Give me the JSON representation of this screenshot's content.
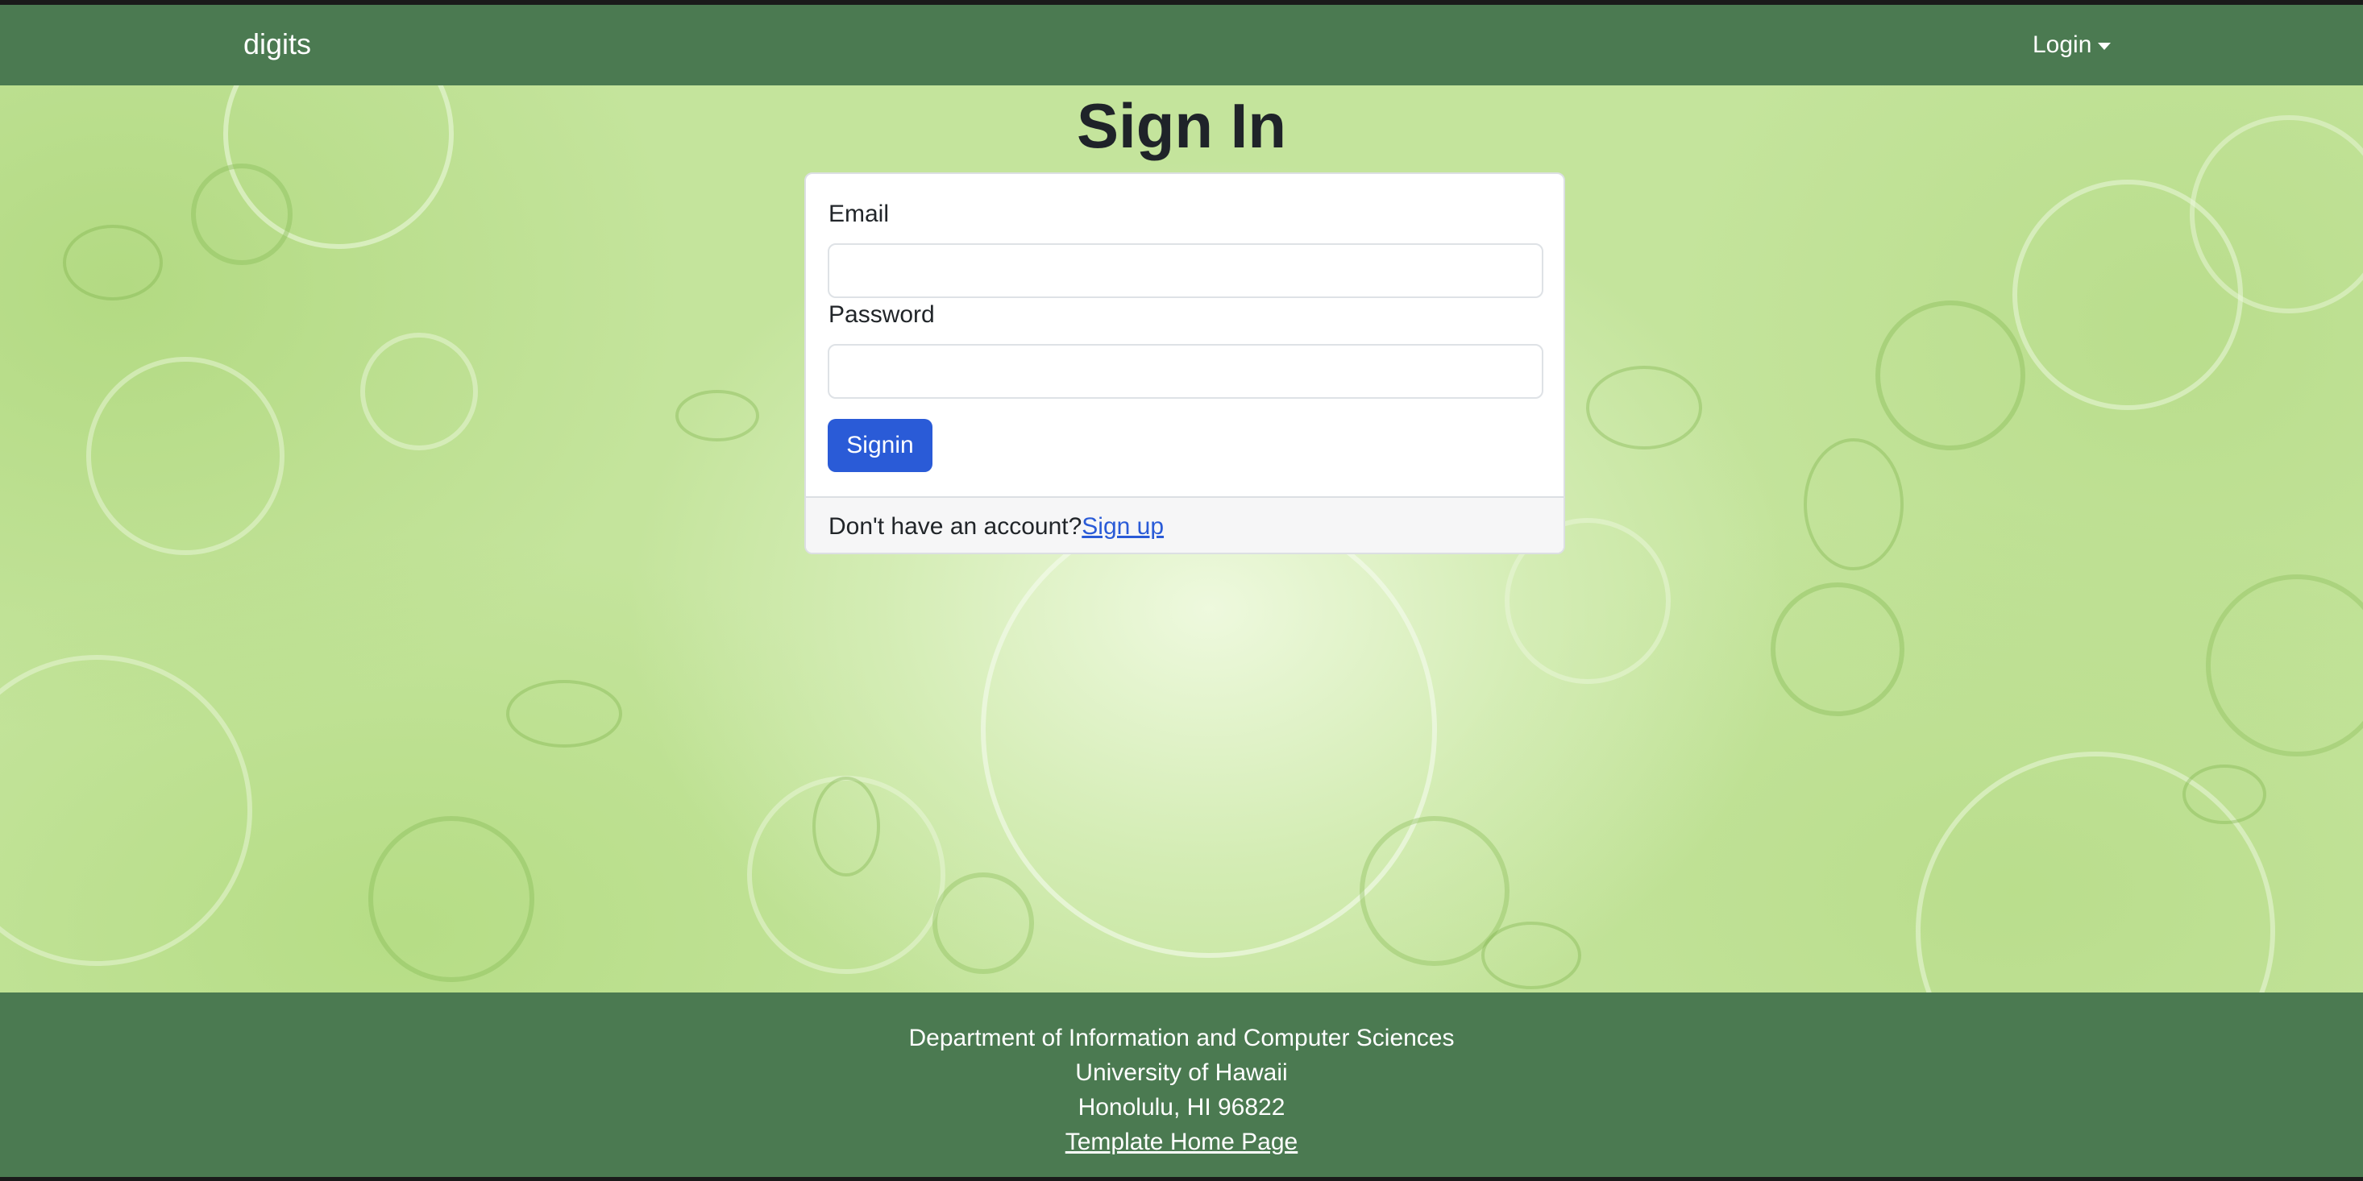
{
  "navbar": {
    "brand": "digits",
    "login_menu": "Login"
  },
  "page": {
    "title": "Sign In"
  },
  "form": {
    "email_label": "Email",
    "email_value": "",
    "password_label": "Password",
    "password_value": "",
    "submit_label": "Signin",
    "footer_prompt": "Don't have an account?",
    "signup_link": "Sign up"
  },
  "footer": {
    "line1": "Department of Information and Computer Sciences",
    "line2": "University of Hawaii",
    "line3": "Honolulu, HI 96822",
    "link": "Template Home Page"
  },
  "colors": {
    "navbar_bg": "#4b7a51",
    "primary_button": "#2a5bd7",
    "link": "#2a5bd7",
    "background_green": "#c4e49c"
  },
  "icons": {
    "dropdown": "caret-down-icon"
  }
}
